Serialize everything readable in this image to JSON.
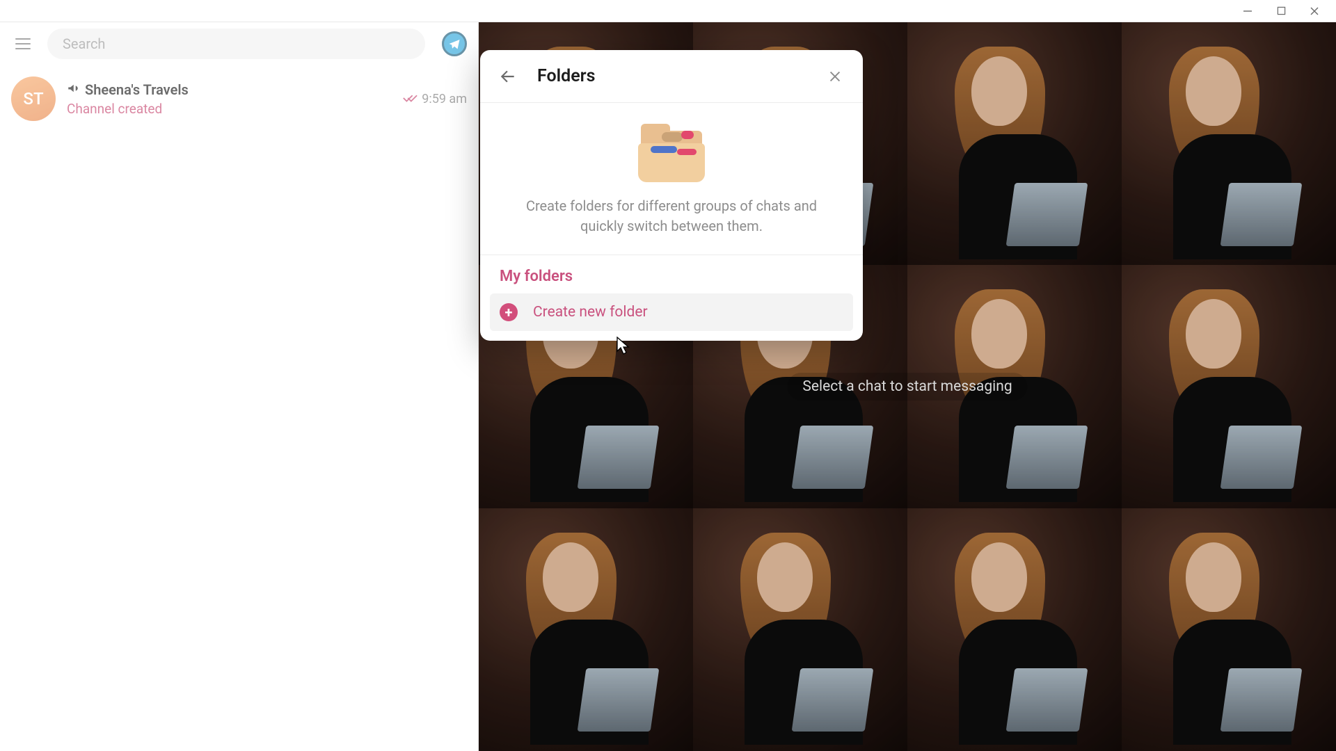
{
  "window": {
    "search_placeholder": "Search"
  },
  "chat": {
    "avatar_initials": "ST",
    "name": "Sheena's Travels",
    "subtitle": "Channel created",
    "time": "9:59 am"
  },
  "right": {
    "empty_hint": "Select a chat to start messaging"
  },
  "modal": {
    "title": "Folders",
    "description": "Create folders for different groups of chats and quickly switch between them.",
    "section_label": "My folders",
    "create_label": "Create new folder"
  },
  "colors": {
    "accent": "#c9517e"
  }
}
